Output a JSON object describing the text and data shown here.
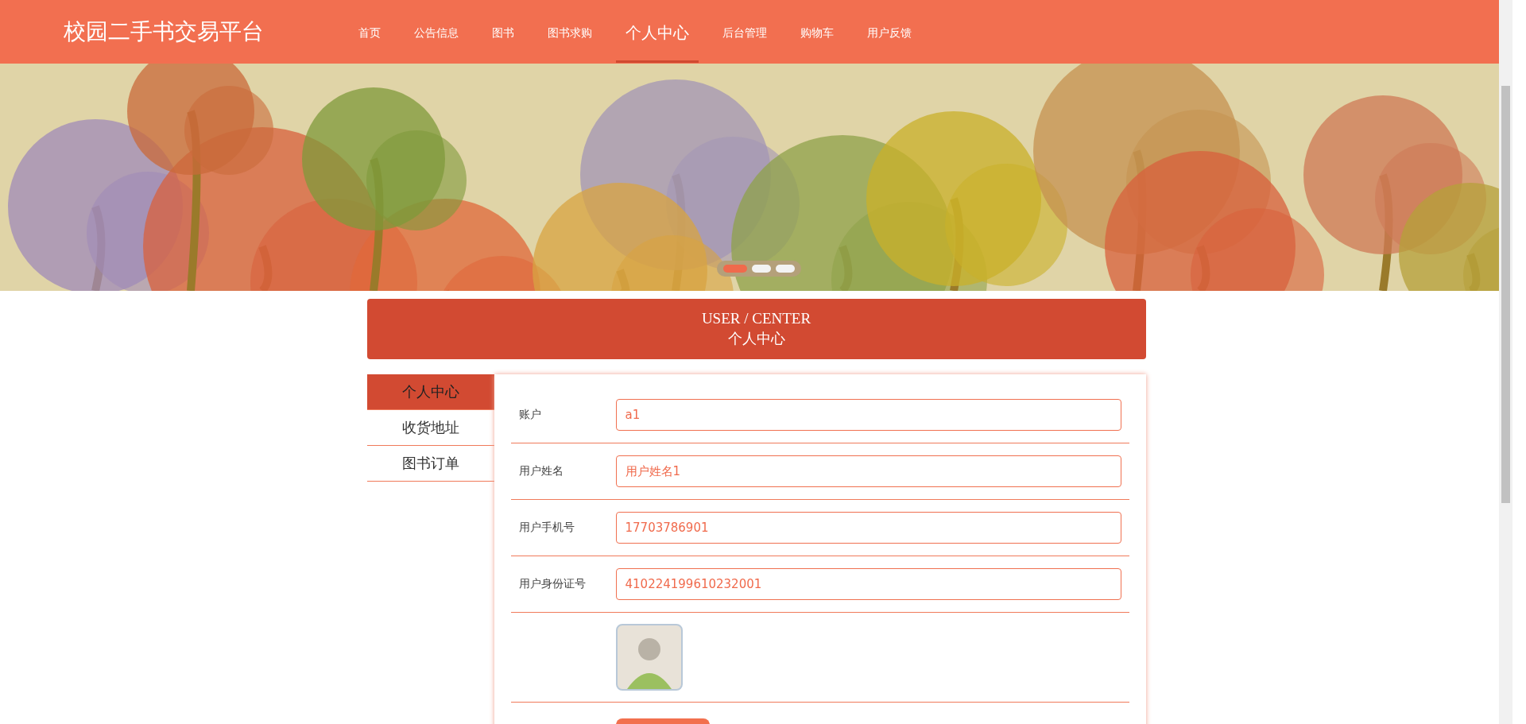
{
  "header": {
    "site_title": "校园二手书交易平台",
    "nav": [
      {
        "label": "首页",
        "selected": false
      },
      {
        "label": "公告信息",
        "selected": false
      },
      {
        "label": "图书",
        "selected": false
      },
      {
        "label": "图书求购",
        "selected": false
      },
      {
        "label": "个人中心",
        "selected": true
      },
      {
        "label": "后台管理",
        "selected": false
      },
      {
        "label": "购物车",
        "selected": false
      },
      {
        "label": "用户反馈",
        "selected": false
      }
    ]
  },
  "banner": {
    "dots": [
      {
        "selected": true
      },
      {
        "selected": false
      },
      {
        "selected": false
      }
    ]
  },
  "section_title": {
    "en": "USER / CENTER",
    "zh": "个人中心"
  },
  "sidebar": {
    "items": [
      {
        "label": "个人中心",
        "selected": true
      },
      {
        "label": "收货地址",
        "selected": false
      },
      {
        "label": "图书订单",
        "selected": false
      }
    ]
  },
  "form": {
    "fields": [
      {
        "kind": "text",
        "label": "账户",
        "value": "a1"
      },
      {
        "kind": "text",
        "label": "用户姓名",
        "value": "用户姓名1"
      },
      {
        "kind": "text",
        "label": "用户手机号",
        "value": "17703786901"
      },
      {
        "kind": "text",
        "label": "用户身份证号",
        "value": "410224199610232001"
      },
      {
        "kind": "avatar"
      },
      {
        "kind": "button"
      }
    ]
  }
}
